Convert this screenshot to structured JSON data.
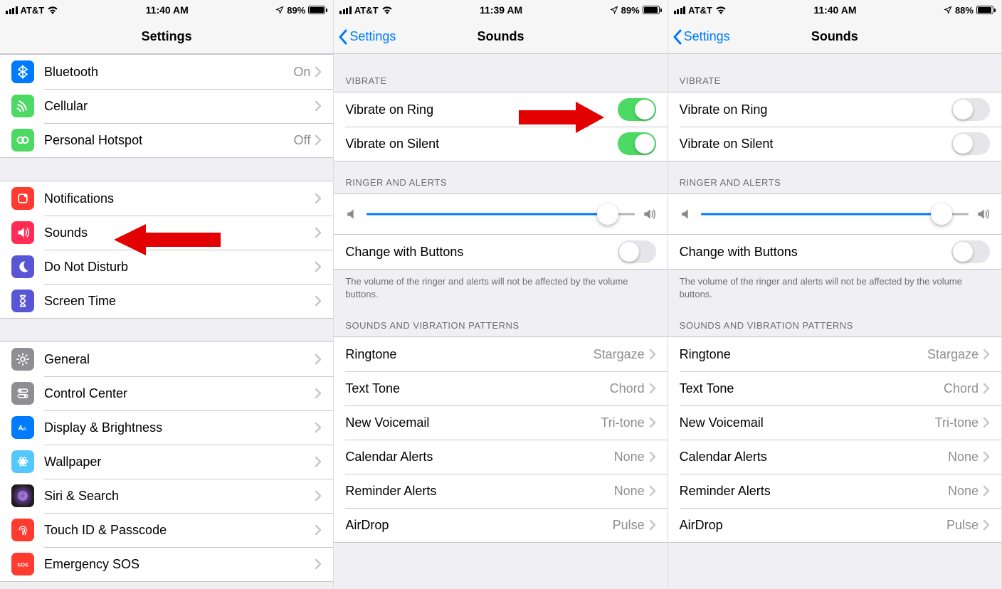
{
  "statusbar": {
    "carrier": "AT&T",
    "times": [
      "11:40 AM",
      "11:39 AM",
      "11:40 AM"
    ],
    "batteries": [
      "89%",
      "89%",
      "88%"
    ],
    "battery_fill_pct": [
      89,
      89,
      88
    ]
  },
  "screen1": {
    "title": "Settings",
    "groups": [
      {
        "rows": [
          {
            "icon": "bluetooth",
            "bg": "#007aff",
            "label": "Bluetooth",
            "value": "On"
          },
          {
            "icon": "cellular",
            "bg": "#4cd964",
            "label": "Cellular",
            "value": ""
          },
          {
            "icon": "hotspot",
            "bg": "#4cd964",
            "label": "Personal Hotspot",
            "value": "Off"
          }
        ]
      },
      {
        "rows": [
          {
            "icon": "notifications",
            "bg": "#ff3b30",
            "label": "Notifications",
            "value": ""
          },
          {
            "icon": "sounds",
            "bg": "#ff2d55",
            "label": "Sounds",
            "value": ""
          },
          {
            "icon": "dnd",
            "bg": "#5856d6",
            "label": "Do Not Disturb",
            "value": ""
          },
          {
            "icon": "screentime",
            "bg": "#5856d6",
            "label": "Screen Time",
            "value": ""
          }
        ]
      },
      {
        "rows": [
          {
            "icon": "general",
            "bg": "#8e8e93",
            "label": "General",
            "value": ""
          },
          {
            "icon": "controlcenter",
            "bg": "#8e8e93",
            "label": "Control Center",
            "value": ""
          },
          {
            "icon": "display",
            "bg": "#007aff",
            "label": "Display & Brightness",
            "value": ""
          },
          {
            "icon": "wallpaper",
            "bg": "#54c7fc",
            "label": "Wallpaper",
            "value": ""
          },
          {
            "icon": "siri",
            "bg": "#1c1c1e",
            "label": "Siri & Search",
            "value": ""
          },
          {
            "icon": "touchid",
            "bg": "#ff3b30",
            "label": "Touch ID & Passcode",
            "value": ""
          },
          {
            "icon": "sos",
            "bg": "#ff3b30",
            "label": "Emergency SOS",
            "value": ""
          }
        ]
      }
    ]
  },
  "sounds_shared": {
    "back_label": "Settings",
    "title": "Sounds",
    "vibrate_header": "VIBRATE",
    "vibrate_ring": "Vibrate on Ring",
    "vibrate_silent": "Vibrate on Silent",
    "ringer_header": "RINGER AND ALERTS",
    "change_buttons": "Change with Buttons",
    "ringer_footer": "The volume of the ringer and alerts will not be affected by the volume buttons.",
    "patterns_header": "SOUNDS AND VIBRATION PATTERNS",
    "patterns": [
      {
        "label": "Ringtone",
        "value": "Stargaze"
      },
      {
        "label": "Text Tone",
        "value": "Chord"
      },
      {
        "label": "New Voicemail",
        "value": "Tri-tone"
      },
      {
        "label": "Calendar Alerts",
        "value": "None"
      },
      {
        "label": "Reminder Alerts",
        "value": "None"
      },
      {
        "label": "AirDrop",
        "value": "Pulse"
      }
    ],
    "slider_pct": 90
  },
  "screen2": {
    "vibrate_ring_on": true,
    "vibrate_silent_on": true,
    "change_buttons_on": false
  },
  "screen3": {
    "vibrate_ring_on": false,
    "vibrate_silent_on": false,
    "change_buttons_on": false
  }
}
